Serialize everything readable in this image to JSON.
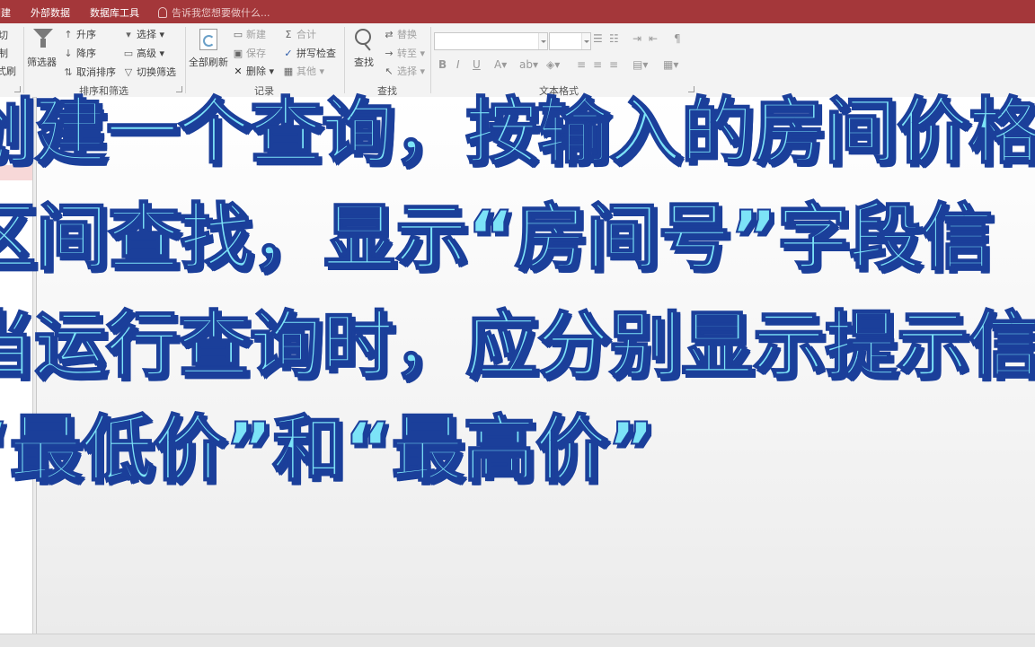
{
  "menubar": {
    "items": [
      "创建",
      "外部数据",
      "数据库工具"
    ],
    "tell_me": "告诉我您想要做什么..."
  },
  "ribbon": {
    "sort_filter": {
      "filter": "筛选器",
      "ascending": "升序",
      "descending": "降序",
      "clear_sort": "取消排序",
      "select": "选择",
      "advanced": "高级",
      "toggle_filter": "切换筛选",
      "group_label": "排序和筛选"
    },
    "records": {
      "refresh_all": "全部刷新",
      "new": "新建",
      "save": "保存",
      "delete": "删除",
      "totals": "合计",
      "spelling": "拼写检查",
      "more": "其他",
      "group_label": "记录"
    },
    "find": {
      "find": "查找",
      "replace": "替换",
      "goto": "转至",
      "select": "选择",
      "group_label": "查找"
    },
    "text_format": {
      "group_label": "文本格式"
    },
    "clipboard_partial": [
      "切",
      "制",
      "式刷"
    ]
  },
  "caption": {
    "lines": [
      "创建一个查询，按输入的房间价格",
      "区间查找，显示“房间号”字段信",
      "当运行查询时，应分别显示提示信",
      "“最低价”和“最高价”"
    ]
  },
  "colors": {
    "title_bar": "#a4373a",
    "caption_fill": "#7ce3f7",
    "caption_outline": "#1b3f9a"
  }
}
